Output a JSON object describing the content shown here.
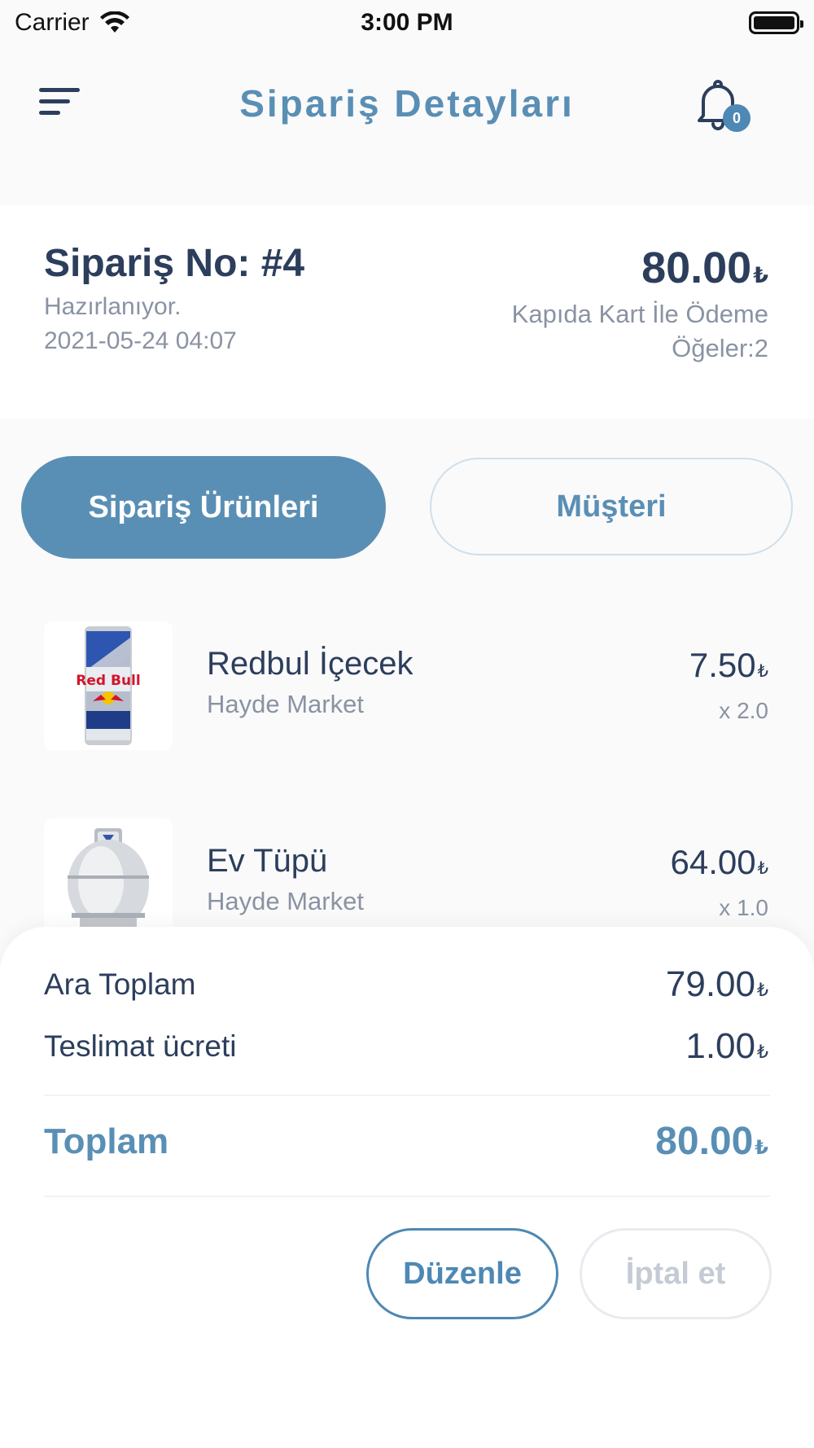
{
  "status_bar": {
    "carrier": "Carrier",
    "time": "3:00 PM"
  },
  "header": {
    "title": "Sipariş Detayları",
    "notification_count": "0",
    "accent_color": "#5a8fb5"
  },
  "order": {
    "number": "Sipariş No: #4",
    "status": "Hazırlanıyor.",
    "date": "2021-05-24 04:07",
    "total": "80.00",
    "currency": "₺",
    "payment_method": "Kapıda Kart İle Ödeme",
    "items_count": "Öğeler:2"
  },
  "tabs": [
    {
      "label": "Sipariş Ürünleri",
      "active": true
    },
    {
      "label": "Müşteri",
      "active": false
    }
  ],
  "products": [
    {
      "name": "Redbul İçecek",
      "store": "Hayde Market",
      "price": "7.50",
      "quantity": "x 2.0",
      "image": "red-bull-can"
    },
    {
      "name": "Ev Tüpü",
      "store": "Hayde Market",
      "price": "64.00",
      "quantity": "x 1.0",
      "image": "gas-cylinder"
    }
  ],
  "summary": {
    "subtotal_label": "Ara Toplam",
    "subtotal_value": "79.00",
    "delivery_label": "Teslimat ücreti",
    "delivery_value": "1.00",
    "total_label": "Toplam",
    "total_value": "80.00",
    "currency": "₺"
  },
  "actions": {
    "edit_label": "Düzenle",
    "cancel_label": "İptal et"
  }
}
